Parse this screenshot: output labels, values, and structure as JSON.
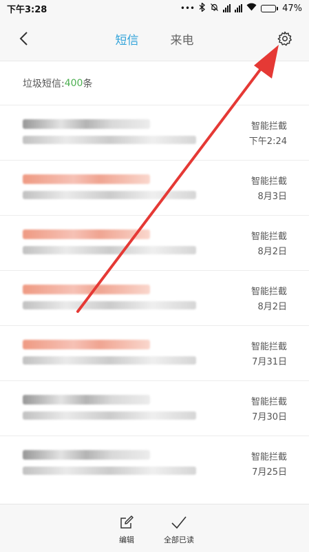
{
  "status_bar": {
    "time": "下午3:28",
    "dots": "•••",
    "battery_percent": "47%",
    "battery_level": 0.47
  },
  "header": {
    "tabs": [
      {
        "label": "短信",
        "active": true
      },
      {
        "label": "来电",
        "active": false
      }
    ]
  },
  "summary": {
    "prefix": "垃圾短信:",
    "count": "400",
    "suffix": "条"
  },
  "messages": [
    {
      "tag": "智能拦截",
      "time": "下午2:24",
      "sender_style": "dark"
    },
    {
      "tag": "智能拦截",
      "time": "8月3日",
      "sender_style": "red"
    },
    {
      "tag": "智能拦截",
      "time": "8月2日",
      "sender_style": "red"
    },
    {
      "tag": "智能拦截",
      "time": "8月2日",
      "sender_style": "red"
    },
    {
      "tag": "智能拦截",
      "time": "7月31日",
      "sender_style": "red"
    },
    {
      "tag": "智能拦截",
      "time": "7月30日",
      "sender_style": "dark"
    },
    {
      "tag": "智能拦截",
      "time": "7月25日",
      "sender_style": "dark"
    }
  ],
  "bottom_bar": {
    "edit_label": "编辑",
    "mark_all_read_label": "全部已读"
  },
  "colors": {
    "accent": "#2fa2d9",
    "count": "#4caf50",
    "arrow": "#e53935"
  }
}
